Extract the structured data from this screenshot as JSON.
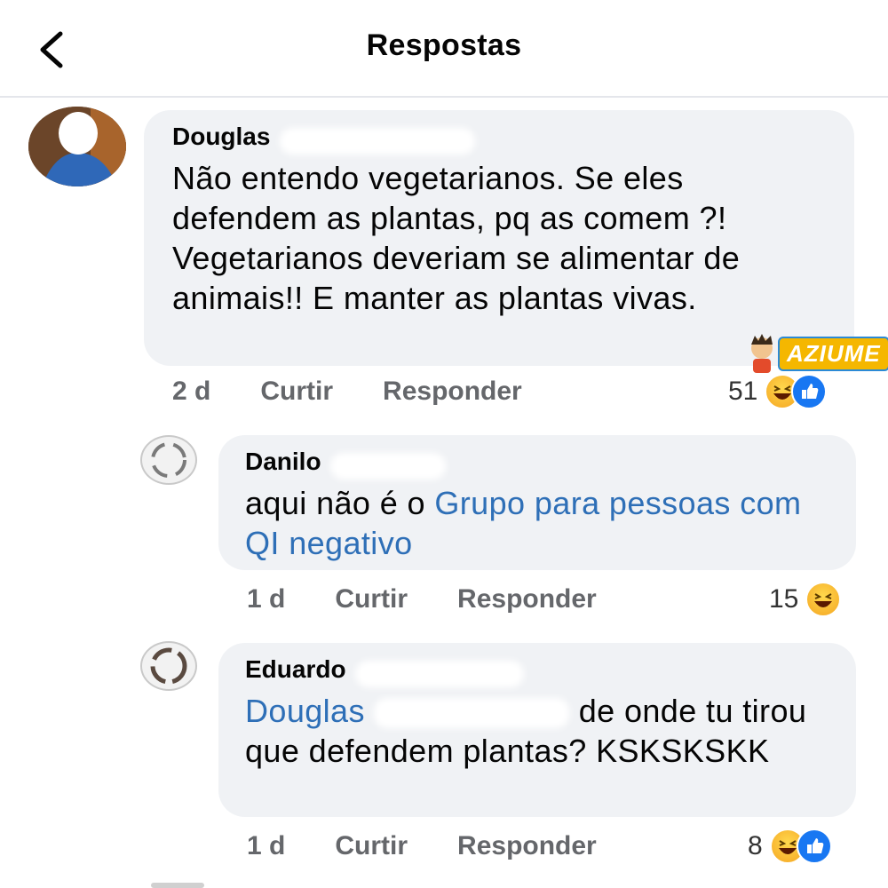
{
  "header": {
    "title": "Respostas"
  },
  "comments": [
    {
      "author": "Douglas",
      "text": "Não entendo vegetarianos. Se eles defendem as plantas, pq as comem ?! Vegetarianos deveriam se alimentar de animais!! E manter as plantas vivas.",
      "time": "2 d",
      "like_label": "Curtir",
      "reply_label": "Responder",
      "reaction_count": "51",
      "reactions": [
        "haha-icon",
        "like-icon"
      ]
    },
    {
      "author": "Danilo",
      "text_prefix": "aqui não é o ",
      "link_text": "Grupo para pessoas com QI negativo",
      "time": "1 d",
      "like_label": "Curtir",
      "reply_label": "Responder",
      "reaction_count": "15",
      "reactions": [
        "haha-icon"
      ]
    },
    {
      "author": "Eduardo",
      "mention": "Douglas",
      "text": "de onde tu tirou que defendem plantas? KSKSKSKK",
      "time": "1 d",
      "like_label": "Curtir",
      "reply_label": "Responder",
      "reaction_count": "8",
      "reactions": [
        "haha-icon",
        "like-icon"
      ]
    }
  ],
  "watermark": {
    "text": "AZIUME"
  },
  "colors": {
    "bubble": "#f0f2f5",
    "link": "#2e6fb7",
    "meta": "#65676b",
    "like": "#1877f2",
    "haha": "#f5a623"
  }
}
